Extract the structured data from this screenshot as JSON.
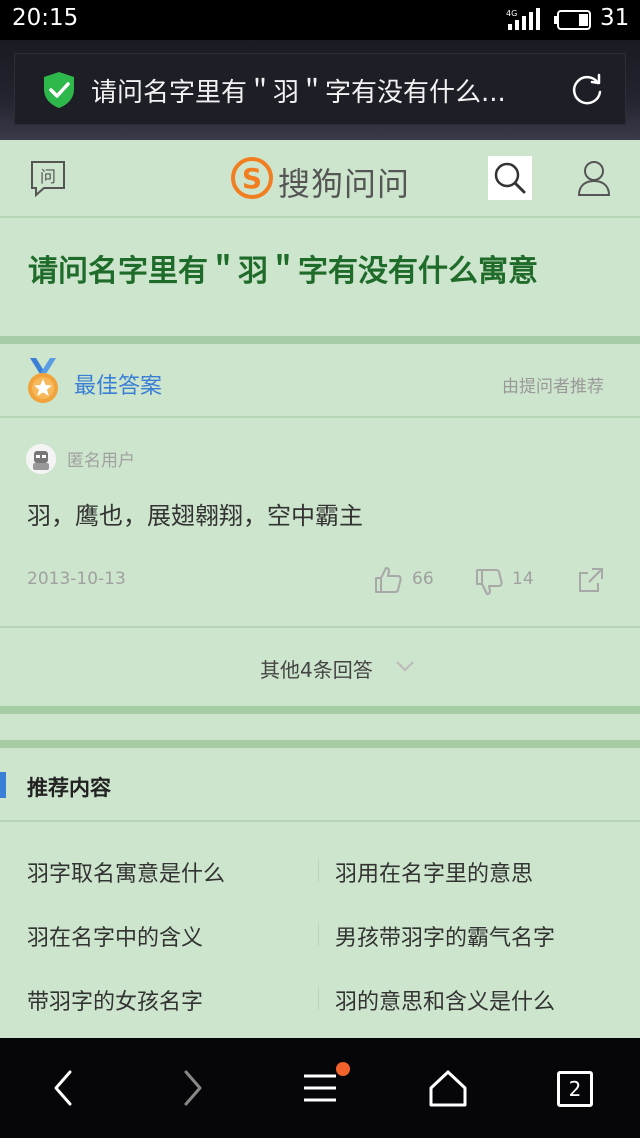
{
  "status_bar": {
    "time": "20:15",
    "network": "4G",
    "battery_level": "31"
  },
  "browser": {
    "url_title": "请问名字里有＂羽＂字有没有什么...",
    "secure_icon": "shield-check-icon",
    "refresh_icon": "refresh-icon"
  },
  "site": {
    "logo_text": "搜狗问问",
    "ask_icon": "问",
    "accent": "#3a7fd6",
    "title_color": "#1f6b2a"
  },
  "question": {
    "title": "请问名字里有＂羽＂字有没有什么寓意"
  },
  "best_answer": {
    "label": "最佳答案",
    "recommended_by": "由提问者推荐",
    "user": "匿名用户",
    "text": "羽，鹰也，展翅翱翔，空中霸主",
    "date": "2013-10-13",
    "likes": "66",
    "dislikes": "14"
  },
  "other_answers": {
    "label": "其他4条回答"
  },
  "recommended": {
    "title": "推荐内容",
    "items": [
      "羽字取名寓意是什么",
      "羽用在名字里的意思",
      "羽在名字中的含义",
      "男孩带羽字的霸气名字",
      "带羽字的女孩名字",
      "羽的意思和含义是什么"
    ]
  },
  "bottom_nav": {
    "tab_count": "2"
  }
}
